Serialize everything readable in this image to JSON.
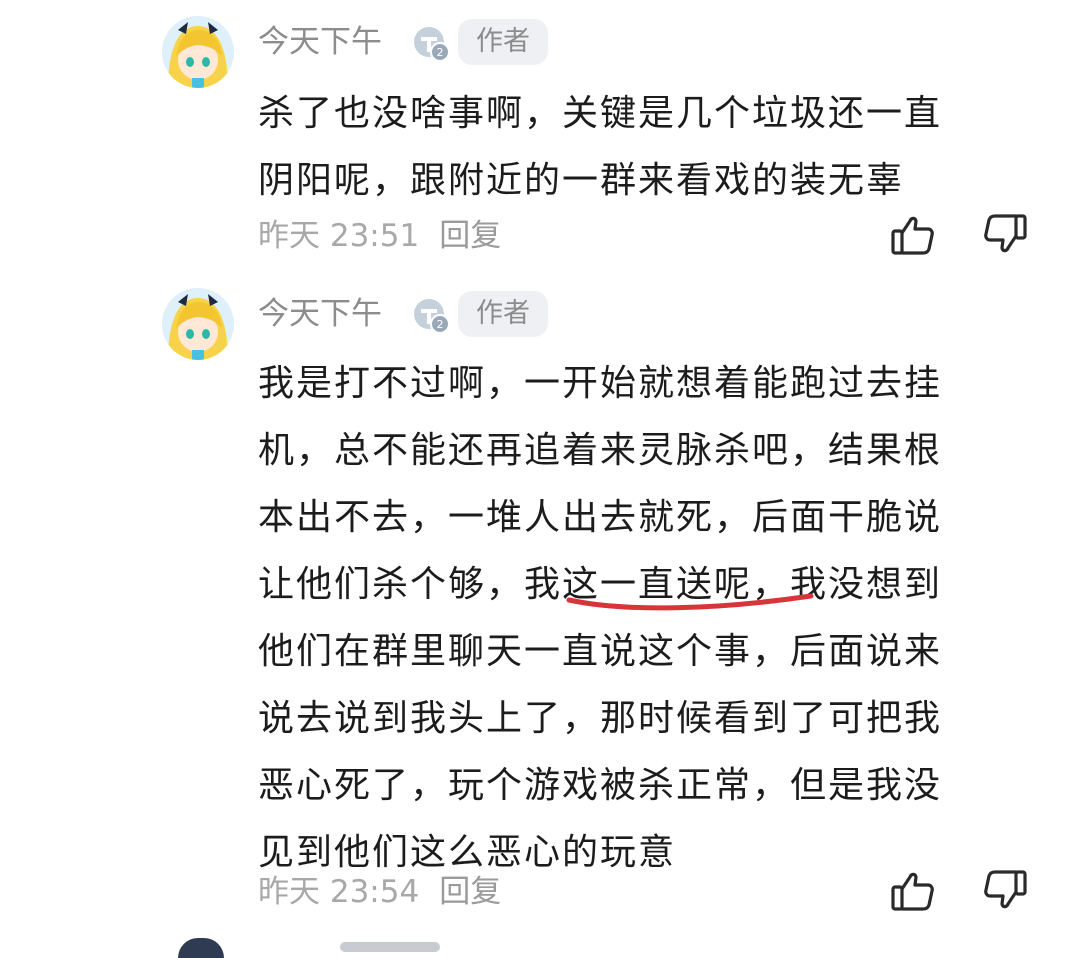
{
  "comments": [
    {
      "username": "今天下午",
      "level": "2",
      "author_tag": "作者",
      "lines": [
        "杀了也没啥事啊，关键是几个垃圾还一直",
        "阴阳呢，跟附近的一群来看戏的装无辜"
      ],
      "time": "昨天 23:51",
      "reply_label": "回复"
    },
    {
      "username": "今天下午",
      "level": "2",
      "author_tag": "作者",
      "lines": [
        "我是打不过啊，一开始就想着能跑过去挂",
        "机，总不能还再追着来灵脉杀吧，结果根",
        "本出不去，一堆人出去就死，后面干脆说",
        "让他们杀个够，我这一直送呢，我没想到",
        "他们在群里聊天一直说这个事，后面说来",
        "说去说到我头上了，那时候看到了可把我",
        "恶心死了，玩个游戏被杀正常，但是我没",
        "见到他们这么恶心的玩意"
      ],
      "time": "昨天 23:54",
      "reply_label": "回复"
    }
  ],
  "icons": {
    "like": "thumbs-up-icon",
    "dislike": "thumbs-down-icon",
    "level_badge": "level-badge-icon"
  },
  "colors": {
    "text_primary": "#1c1c1c",
    "text_secondary": "#8c8c8c",
    "tag_background": "#eef0f3",
    "underline_mark": "#d9343a"
  }
}
